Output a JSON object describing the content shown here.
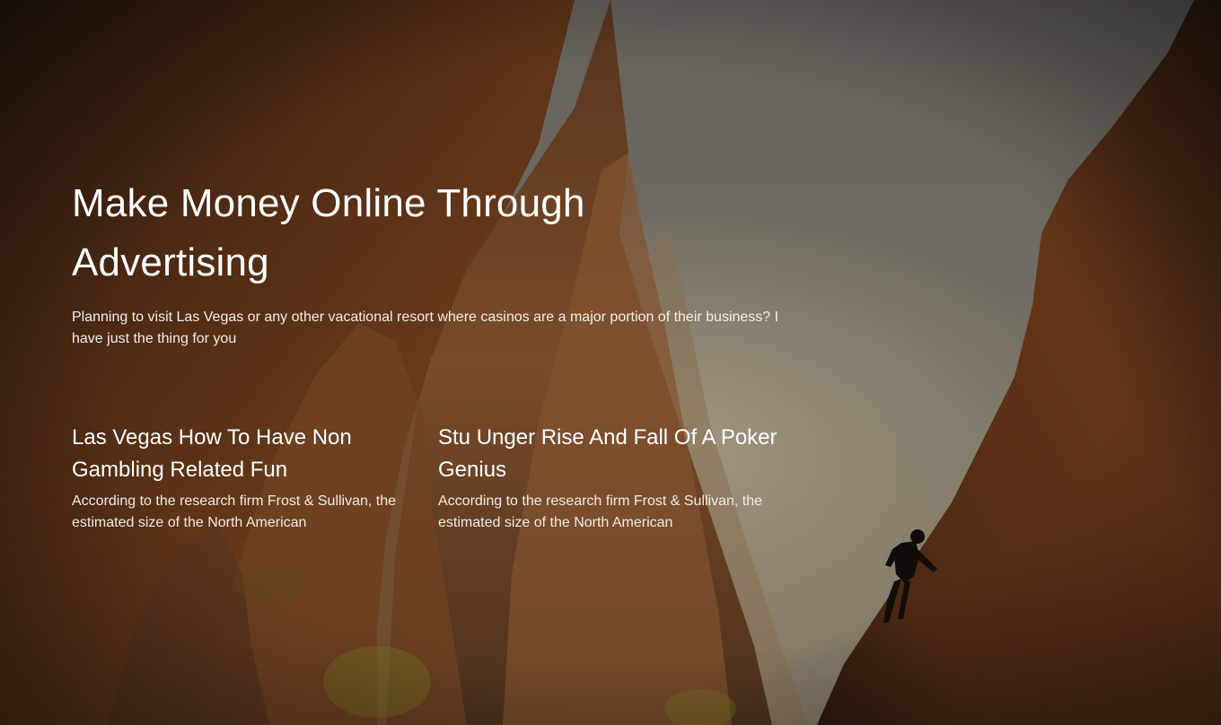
{
  "hero": {
    "title": "Make Money Online Through Advertising",
    "lead": "Planning to visit Las Vegas or any other vacational resort where casinos are a major portion of their business? I have just the thing for you"
  },
  "posts": [
    {
      "title": "Las Vegas How To Have Non Gambling Related Fun",
      "excerpt": "According to the research firm Frost & Sullivan, the estimated size of the North American"
    },
    {
      "title": "Stu Unger Rise And Fall Of A Poker Genius",
      "excerpt": "According to the research firm Frost & Sullivan, the estimated size of the North American"
    }
  ],
  "colors": {
    "text": "#ffffff",
    "sky": "#9a9388",
    "rock": "#8a4a22",
    "overlay": "#000000"
  }
}
